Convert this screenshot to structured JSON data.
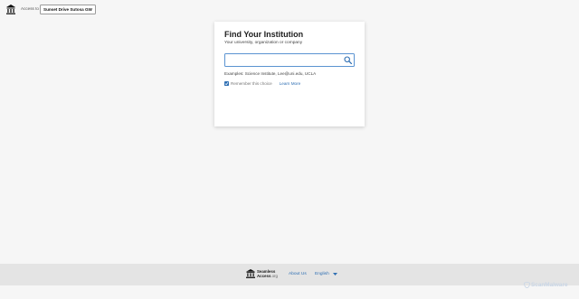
{
  "header": {
    "access_label": "Access to",
    "service_provider": "Sunset Drive Sutosa GW"
  },
  "card": {
    "title": "Find Your Institution",
    "subtitle": "Your university, organization or company",
    "search": {
      "value": "",
      "placeholder": ""
    },
    "examples": "Examples: Science Institute, Lee@uni.edu, UCLA",
    "remember": {
      "checked": true,
      "label": "Remember this choice"
    },
    "learn_more": "Learn More"
  },
  "footer": {
    "logo_line1": "Seamless",
    "logo_line2": "Access",
    "logo_org": ".org",
    "about": "About Us",
    "language": "English"
  },
  "watermark": "ScanMalware",
  "colors": {
    "accent": "#2f6fb3",
    "background": "#f6f6f6",
    "footer": "#e4e4e4",
    "focus_border": "#5a93d1"
  }
}
